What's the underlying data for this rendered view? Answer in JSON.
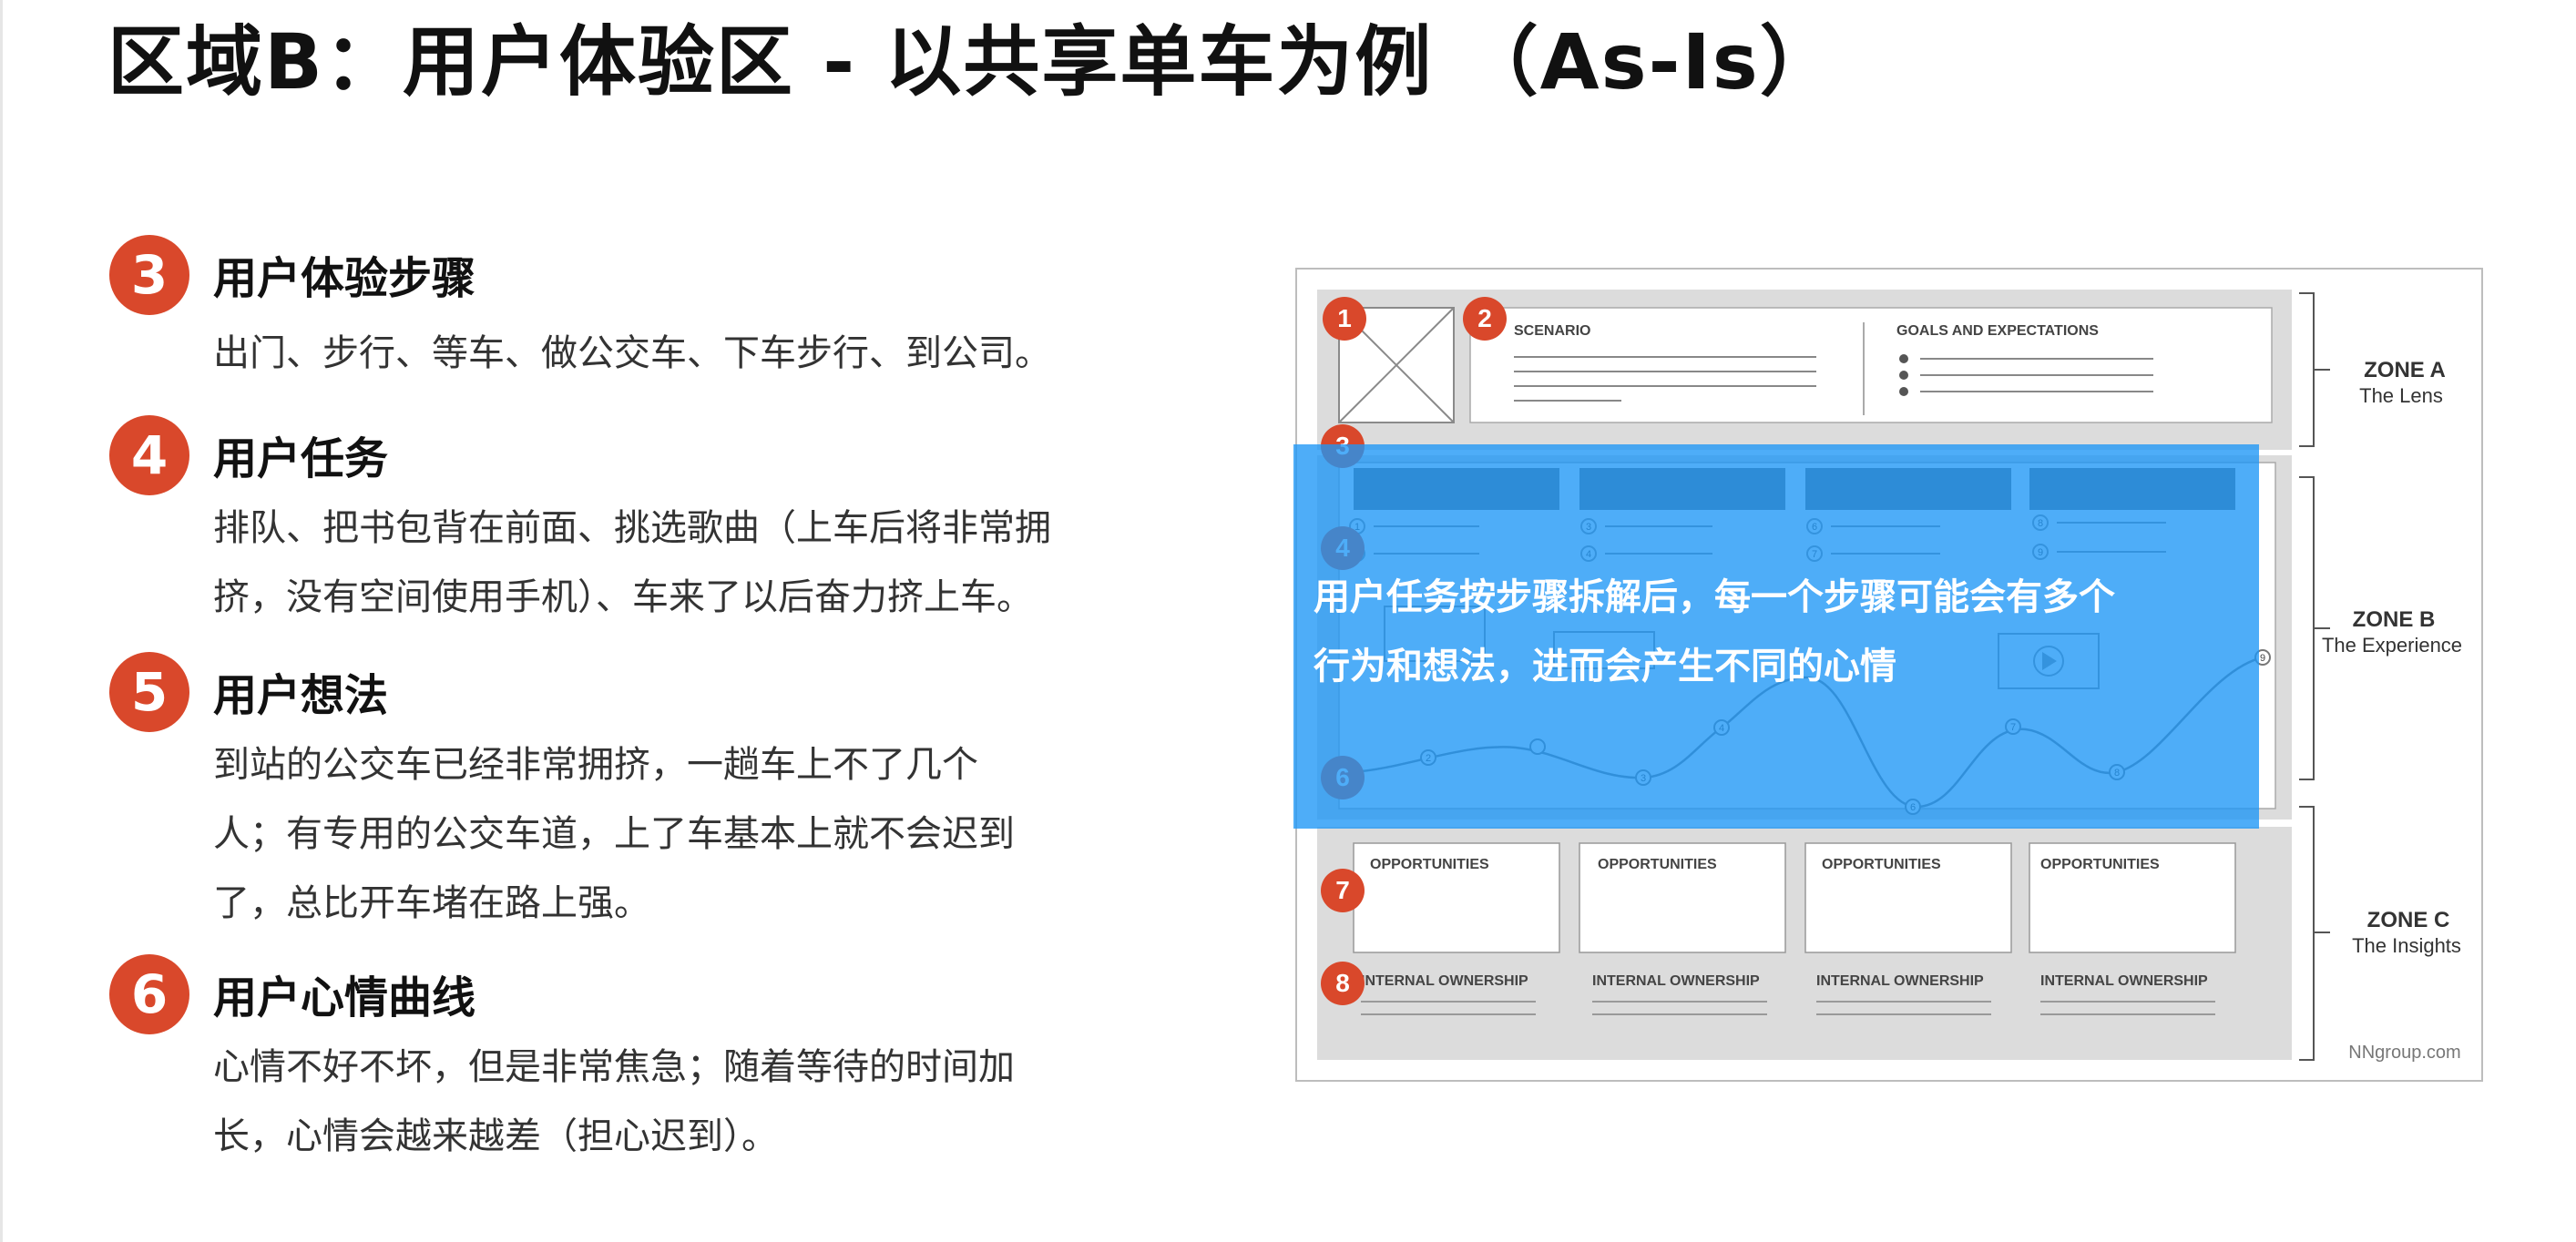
{
  "title": "区域B：用户体验区 - 以共享单车为例 （As-Is）",
  "steps": [
    {
      "num": "3",
      "title": "用户体验步骤",
      "lines": [
        "出门、步行、等车、做公交车、下车步行、到公司。"
      ]
    },
    {
      "num": "4",
      "title": "用户任务",
      "lines": [
        "排队、把书包背在前面、挑选歌曲（上车后将非常拥",
        "挤，没有空间使用手机）、车来了以后奋力挤上车。"
      ]
    },
    {
      "num": "5",
      "title": "用户想法",
      "lines": [
        "到站的公交车已经非常拥挤，一趟车上不了几个",
        "人；有专用的公交车道，上了车基本上就不会迟到",
        "了，总比开车堵在路上强。"
      ]
    },
    {
      "num": "6",
      "title": "用户心情曲线",
      "lines": [
        "心情不好不坏，但是非常焦急；随着等待的时间加",
        "长，心情会越来越差（担心迟到）。"
      ]
    }
  ],
  "figure": {
    "badges": [
      "1",
      "2",
      "3",
      "4",
      "6",
      "7",
      "8"
    ],
    "scenario": "SCENARIO",
    "goals": "GOALS AND EXPECTATIONS",
    "zones": [
      {
        "name": "ZONE A",
        "sub": "The Lens"
      },
      {
        "name": "ZONE B",
        "sub": "The Experience"
      },
      {
        "name": "ZONE C",
        "sub": "The Insights"
      }
    ],
    "opportunities": [
      "OPPORTUNITIES",
      "OPPORTUNITIES",
      "OPPORTUNITIES",
      "OPPORTUNITIES"
    ],
    "ownership": [
      "INTERNAL OWNERSHIP",
      "INTERNAL OWNERSHIP",
      "INTERNAL OWNERSHIP",
      "INTERNAL OWNERSHIP"
    ],
    "list_nums": [
      "1",
      "2",
      "3",
      "4",
      "6",
      "7",
      "8",
      "9"
    ],
    "curve_points": [
      "2",
      "3",
      "4",
      "6",
      "7",
      "8",
      "9"
    ],
    "credit": "NNgroup.com"
  },
  "overlay": {
    "lines": [
      "用户任务按步骤拆解后，每一个步骤可能会有多个",
      "行为和想法，进而会产生不同的心情"
    ]
  },
  "colors": {
    "accent": "#d9482b",
    "overlay": "#1c96f6",
    "zone_bg": "#dcdcdc"
  }
}
